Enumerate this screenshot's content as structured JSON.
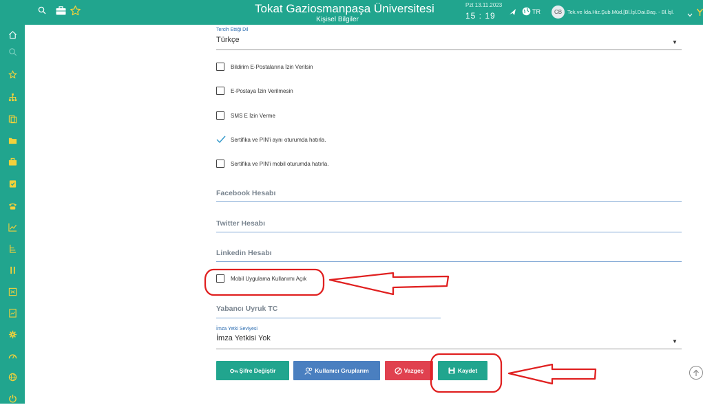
{
  "header": {
    "title": "Tokat Gaziosmanpaşa Üniversitesi",
    "subtitle": "Kişisel Bilgiler",
    "date": "Pzt 13.11.2023",
    "time": "15 : 19",
    "language": "TR",
    "user_initials": "CB",
    "user_text": "Tek.ve İda.Hiz.Şub.Müd.[Bl.İşl.Dai.Baş. - Bl.İşl."
  },
  "sidebar": {
    "icons": [
      "home-icon",
      "search-icon",
      "star-icon",
      "org-chart-icon",
      "copy-icon",
      "folder-icon",
      "briefcase-icon",
      "clipboard-icon",
      "phone-icon",
      "chart-line-icon",
      "hierarchy-icon",
      "bars-icon",
      "inbox-icon",
      "document-icon",
      "gear-icon",
      "gauge-icon",
      "globe-icon",
      "power-icon"
    ]
  },
  "form": {
    "language_label": "Tercih Ettiği Dil",
    "language_value": "Türkçe",
    "checkboxes": [
      {
        "label": "Bildirim E-Postalarına İzin Verilsin",
        "checked": false
      },
      {
        "label": "E-Postaya İzin Verilmesin",
        "checked": false
      },
      {
        "label": "SMS E İzin Verme",
        "checked": false
      },
      {
        "label": "Sertifika ve PIN'i aynı oturumda hatırla.",
        "checked": true
      },
      {
        "label": "Sertifika ve PIN'i mobil oturumda hatırla.",
        "checked": false
      }
    ],
    "facebook_placeholder": "Facebook Hesabı",
    "twitter_placeholder": "Twitter Hesabı",
    "linkedin_placeholder": "Linkedin Hesabı",
    "mobile_label": "Mobil Uygulama Kullanımı Açık",
    "foreign_tc_placeholder": "Yabancı Uyruk TC",
    "signature_label": "İmza Yetki Seviyesi",
    "signature_value": "İmza Yetkisi Yok"
  },
  "buttons": {
    "change_password": "Şifre Değiştir",
    "user_groups": "Kullanıcı Gruplarım",
    "cancel": "Vazgeç",
    "save": "Kaydet"
  },
  "colors": {
    "brand": "#21a58e",
    "annotation": "#e02020",
    "cancel": "#e0414f",
    "user_groups": "#4a7fc0"
  }
}
